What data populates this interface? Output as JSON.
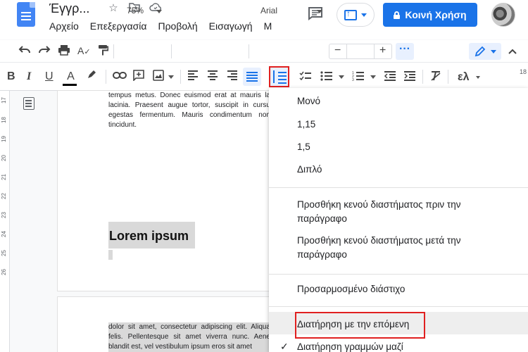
{
  "document": {
    "title": "Έγγρ...",
    "menu": [
      "Αρχείο",
      "Επεξεργασία",
      "Προβολή",
      "Εισαγωγή",
      "Μ"
    ]
  },
  "header": {
    "share_label": "Κοινή Χρήση"
  },
  "toolbar": {
    "zoom": "75%",
    "font": "Arial",
    "language_label": "ελ"
  },
  "ruler_marks": [
    "17",
    "18",
    "19",
    "20",
    "21",
    "22",
    "23",
    "24",
    "25",
    "26"
  ],
  "page1": {
    "paragraph": "tempus metus. Donec euismod erat at mauris la lacinia. Praesent augue tortor, suscipit in cursu egestas fermentum. Mauris condimentum non tincidunt.",
    "heading": "Lorem ipsum"
  },
  "page2": {
    "paragraph": "dolor sit amet, consectetur adipiscing elit. Aliqua felis. Pellentesque sit amet viverra nunc. Aene blandit est, vel vestibulum ipsum eros sit amet"
  },
  "spacing_menu": {
    "items": [
      {
        "label": "Μονό"
      },
      {
        "label": "1,15"
      },
      {
        "label": "1,5"
      },
      {
        "label": "Διπλό"
      },
      {
        "label": "Προσθήκη κενού διαστήματος πριν την παράγραφο"
      },
      {
        "label": "Προσθήκη κενού διαστήματος μετά την παράγραφο"
      },
      {
        "label": "Προσαρμοσμένο διάστιχο"
      },
      {
        "label": "Διατήρηση με την επόμενη"
      },
      {
        "label": "Διατήρηση γραμμών μαζί"
      }
    ]
  }
}
